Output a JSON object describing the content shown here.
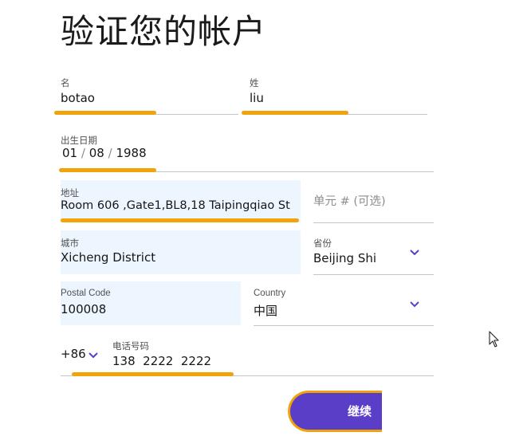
{
  "page": {
    "title": "验证您的帐户"
  },
  "form": {
    "first_name": {
      "label": "名",
      "value": "botao"
    },
    "last_name": {
      "label": "姓",
      "value": "liu"
    },
    "dob": {
      "label": "出生日期",
      "month": "01",
      "day": "08",
      "year": "1988",
      "sep": "/"
    },
    "address": {
      "label": "地址",
      "value": "Room 606 ,Gate1,BL8,18 Taipingqiao St"
    },
    "unit": {
      "placeholder": "单元 # (可选)"
    },
    "city": {
      "label": "城市",
      "value": "Xicheng District"
    },
    "province": {
      "label": "省份",
      "value": "Beijing Shi",
      "icon": "chevron-down-icon"
    },
    "postal": {
      "label": "Postal Code",
      "value": "100008"
    },
    "country": {
      "label": "Country",
      "value": "中国",
      "icon": "chevron-down-icon"
    },
    "phone": {
      "country_code": "+86",
      "label": "电话号码",
      "value": "138  2222  2222",
      "icon": "chevron-down-icon"
    }
  },
  "actions": {
    "continue_label": "继续"
  },
  "colors": {
    "accent": "#5a3ec8",
    "highlight": "#f0a30a",
    "filled_bg": "#edf5ff",
    "underline": "#c6c6c6"
  }
}
